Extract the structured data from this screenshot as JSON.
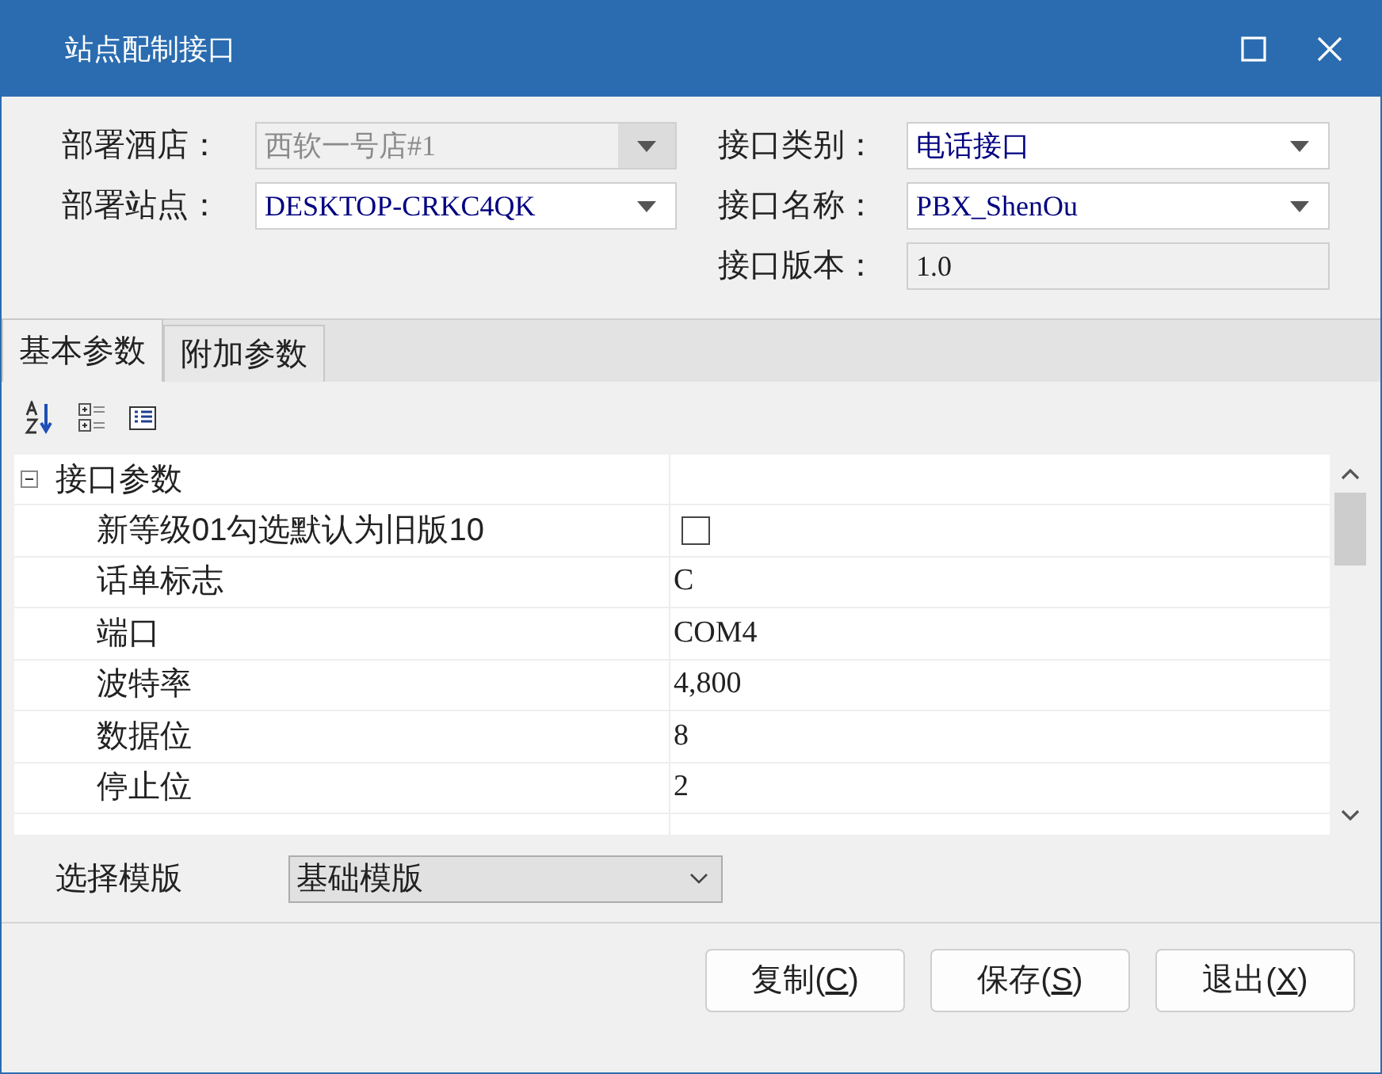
{
  "window": {
    "title": "站点配制接口"
  },
  "form_left": [
    {
      "label": "部署酒店：",
      "value": "西软一号店#1",
      "disabled": true
    },
    {
      "label": "部署站点：",
      "value": "DESKTOP-CRKC4QK",
      "disabled": false
    }
  ],
  "form_right": [
    {
      "label": "接口类别：",
      "value": "电话接口",
      "kind": "combo"
    },
    {
      "label": "接口名称：",
      "value": "PBX_ShenOu",
      "kind": "combo"
    },
    {
      "label": "接口版本：",
      "value": "1.0",
      "kind": "readonly"
    }
  ],
  "tabs": [
    {
      "label": "基本参数",
      "selected": true
    },
    {
      "label": "附加参数",
      "selected": false
    }
  ],
  "property_grid": {
    "category": {
      "label": "接口参数",
      "expanded": true,
      "children": [
        {
          "name": "新等级01勾选默认为旧版10",
          "kind": "checkbox",
          "checked": false
        },
        {
          "name": "话单标志",
          "kind": "text",
          "value": "C"
        },
        {
          "name": "端口",
          "kind": "text",
          "value": "COM4"
        },
        {
          "name": "波特率",
          "kind": "text",
          "value": "4,800"
        },
        {
          "name": "数据位",
          "kind": "text",
          "value": "8"
        },
        {
          "name": "停止位",
          "kind": "text",
          "value": "2"
        }
      ]
    }
  },
  "template": {
    "label": "选择模版",
    "value": "基础模版"
  },
  "buttons": [
    {
      "before": "复制(",
      "mnemonic": "C",
      "after": ")"
    },
    {
      "before": "保存(",
      "mnemonic": "S",
      "after": ")"
    },
    {
      "before": "退出(",
      "mnemonic": "X",
      "after": ")"
    }
  ]
}
